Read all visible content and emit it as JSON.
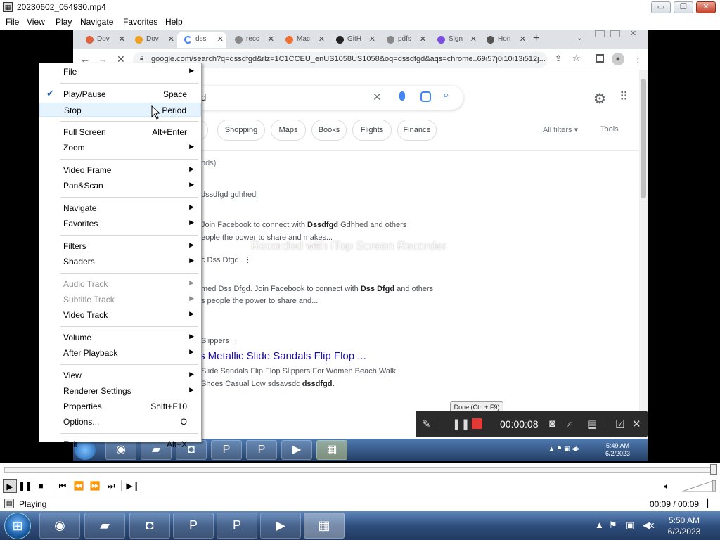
{
  "window": {
    "title": "20230602_054930.mp4",
    "min": "▭",
    "max": "❐",
    "close": "✕"
  },
  "menubar": [
    "File",
    "View",
    "Play",
    "Navigate",
    "Favorites",
    "Help"
  ],
  "browser": {
    "tabs": [
      {
        "label": "Dov",
        "color": "#e0623a"
      },
      {
        "label": "Dov",
        "color": "#f0a020"
      },
      {
        "label": "dss",
        "color": "#4285f4"
      },
      {
        "label": "recc",
        "color": "#888888"
      },
      {
        "label": "Mac",
        "color": "#f07030"
      },
      {
        "label": "GitH",
        "color": "#222222"
      },
      {
        "label": "pdfs",
        "color": "#888888"
      },
      {
        "label": "Sign",
        "color": "#7b4ee0"
      },
      {
        "label": "Hon",
        "color": "#555555"
      }
    ],
    "new_tab": "+",
    "url": "google.com/search?q=dssdfgd&rlz=1C1CCEU_enUS1058US1058&oq=dssdfgd&aqs=chrome..69i57j0i10i13i512j...",
    "search_tail": "d",
    "chips": [
      "s",
      "Shopping",
      "Maps",
      "Books",
      "Flights",
      "Finance"
    ],
    "all_filters": "All filters",
    "tools": "Tools",
    "result_count": "nds)",
    "results": [
      {
        "source": "dssdfgd gdhhed",
        "line1": "Join Facebook to connect with ",
        "bold1": "Dssdfgd",
        "after1": " Gdhhed and others",
        "line2": "eople the power to share and makes..."
      },
      {
        "source": "c Dss Dfgd",
        "line1": "med Dss Dfgd. Join Facebook to connect with ",
        "bold1": "Dss Dfgd",
        "after1": " and others",
        "line2": "s people the power to share and..."
      },
      {
        "source": "Slippers",
        "title": "s Metallic Slide Sandals Flip Flop ...",
        "line1": "Slide Sandals Flip Flop Slippers For Women Beach Walk",
        "line2": "Shoes Casual Low sdsavsdc ",
        "bold2": "dssdfgd."
      }
    ]
  },
  "watermark": "Recorded with iTop Screen Recorder",
  "recorder": {
    "tooltip": "Done (Ctrl + F9)",
    "time": "00:00:08"
  },
  "inner_taskbar": {
    "time": "5:49 AM",
    "date": "6/2/2023"
  },
  "context_menu": [
    {
      "label": "File",
      "submenu": true
    },
    {
      "sep": true
    },
    {
      "label": "Play/Pause",
      "shortcut": "Space",
      "checked": true
    },
    {
      "label": "Stop",
      "shortcut": "Period",
      "highlight": true
    },
    {
      "sep": true
    },
    {
      "label": "Full Screen",
      "shortcut": "Alt+Enter"
    },
    {
      "label": "Zoom",
      "submenu": true
    },
    {
      "sep": true
    },
    {
      "label": "Video Frame",
      "submenu": true
    },
    {
      "label": "Pan&Scan",
      "submenu": true
    },
    {
      "sep": true
    },
    {
      "label": "Navigate",
      "submenu": true
    },
    {
      "label": "Favorites",
      "submenu": true
    },
    {
      "sep": true
    },
    {
      "label": "Filters",
      "submenu": true
    },
    {
      "label": "Shaders",
      "submenu": true
    },
    {
      "sep": true
    },
    {
      "label": "Audio Track",
      "submenu": true,
      "disabled": true
    },
    {
      "label": "Subtitle Track",
      "submenu": true,
      "disabled": true
    },
    {
      "label": "Video Track",
      "submenu": true
    },
    {
      "sep": true
    },
    {
      "label": "Volume",
      "submenu": true
    },
    {
      "label": "After Playback",
      "submenu": true
    },
    {
      "sep": true
    },
    {
      "label": "View",
      "submenu": true
    },
    {
      "label": "Renderer Settings",
      "submenu": true
    },
    {
      "label": "Properties",
      "shortcut": "Shift+F10"
    },
    {
      "label": "Options...",
      "shortcut": "O"
    },
    {
      "sep": true
    },
    {
      "label": "Exit",
      "shortcut": "Alt+X"
    }
  ],
  "status": {
    "state": "Playing",
    "time": "00:09 / 00:09"
  },
  "taskbar": {
    "time": "5:50 AM",
    "date": "6/2/2023"
  }
}
